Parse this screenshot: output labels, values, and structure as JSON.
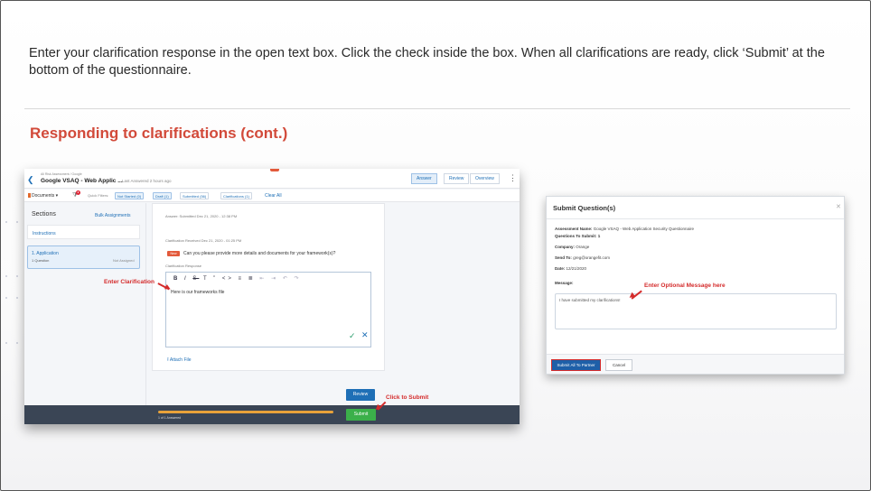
{
  "slide": {
    "instructions": "Enter your clarification response in the open text box. Click the check inside the box. When all clarifications are ready, click ‘Submit’ at the bottom of the questionnaire.",
    "heading": "Responding to clarifications (cont.)",
    "heading_color": "#d24a3a"
  },
  "questionnaire": {
    "breadcrumb": "All Risk Assessment / Google",
    "title": "Google VSAQ - Web Applic ...",
    "last_answered": "Last Answered 2 hours ago",
    "tabs": [
      "Answer",
      "Review",
      "Overview"
    ],
    "documents_label": "Documents",
    "filter_badge": "2",
    "quick_filters_label": "Quick Filters:",
    "chips": [
      "Not Started (0)",
      "Draft (1)",
      "Submitted (56)",
      "Clarifications (1)"
    ],
    "clear_all": "Clear All",
    "sections_title": "Sections",
    "bulk_assignments": "Bulk Assignments",
    "instructions_link": "Instructions",
    "section_name": "1. Application",
    "section_count": "1 Question",
    "section_assignee": "Not Assigned",
    "answer_status": "Answer: Submitted Dec 21, 2020 - 12:38 PM",
    "clarification_status": "Clarification Received Dec 21, 2020 - 01:25 PM",
    "new_badge": "New",
    "clarification_question": "Can you please provide more details and documents for your framework(s)?",
    "response_label": "Clarification Response",
    "editor_tools": [
      "B",
      "I",
      "S",
      "T",
      "”",
      "<>",
      "≡",
      "≣",
      "⇤",
      "⇥",
      "↶",
      "↷"
    ],
    "response_text": "Here is our frameworks file",
    "attach_file": "Attach File",
    "review_button": "Review",
    "progress_text": "1 of 1 Answered",
    "progress": 1.0,
    "submit_button": "Submit",
    "annotation_enter": "Enter Clarification",
    "annotation_click": "Click to Submit"
  },
  "dialog": {
    "title": "Submit Question(s)",
    "assessment_label": "Assessment Name:",
    "assessment_value": "Google VSAQ - Web Application Security Questionnaire",
    "questions_label": "Questions To Submit:",
    "questions_value": "1",
    "company_label": "Company:",
    "company_value": "Orange",
    "send_label": "Send To:",
    "send_value": "greg@orangefit.com",
    "date_label": "Date:",
    "date_value": "12/21/2020",
    "message_label": "Message:",
    "message_text": "I have submitted my clarifications!",
    "annotation_message": "Enter Optional Message here",
    "submit_button": "Submit All To Partner",
    "cancel_button": "Cancel"
  },
  "colors": {
    "annotation": "#d42b2b",
    "accent": "#1e6fb6",
    "submit_green": "#3bb04a"
  }
}
